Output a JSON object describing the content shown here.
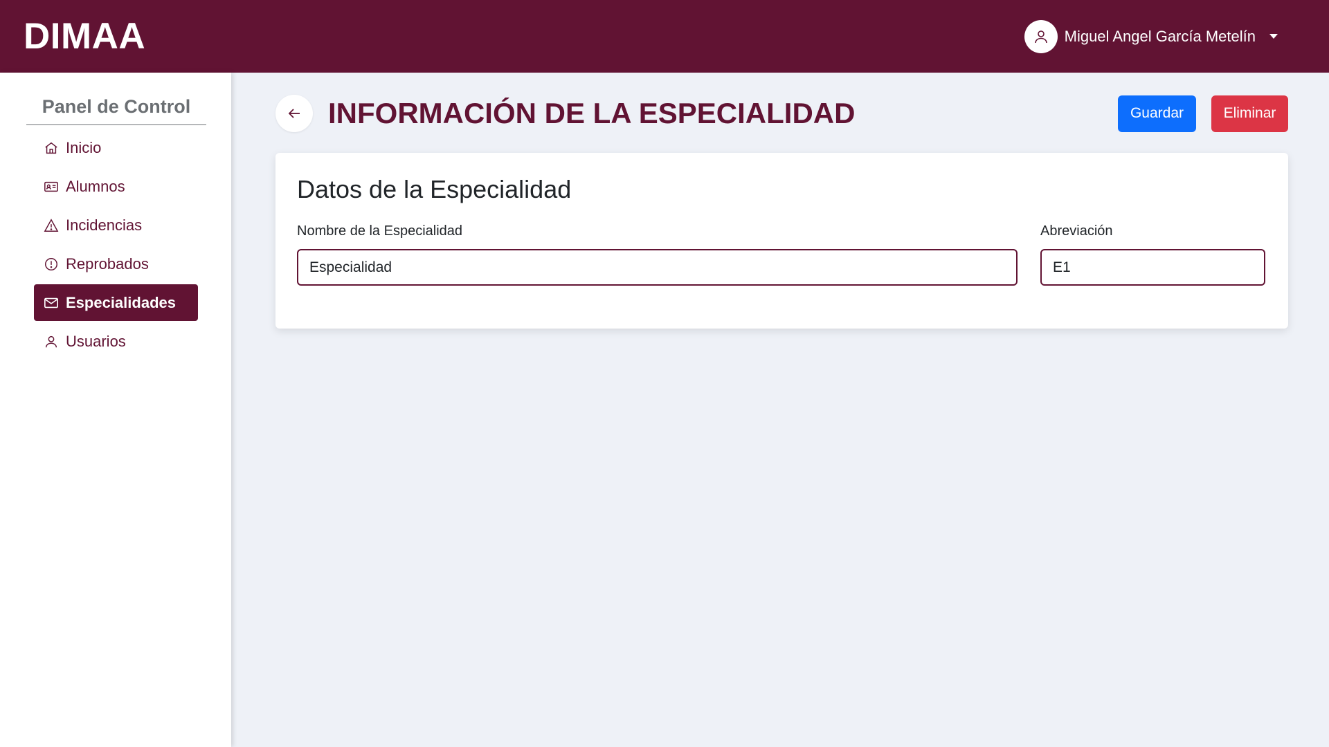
{
  "app": {
    "brand": "DIMAA",
    "user_name": "Miguel Angel García Metelín"
  },
  "sidebar": {
    "title": "Panel de Control",
    "items": [
      {
        "label": "Inicio",
        "icon": "home-icon"
      },
      {
        "label": "Alumnos",
        "icon": "id-card-icon"
      },
      {
        "label": "Incidencias",
        "icon": "warning-triangle-icon"
      },
      {
        "label": "Reprobados",
        "icon": "exclamation-circle-icon"
      },
      {
        "label": "Especialidades",
        "icon": "envelope-icon",
        "active": true
      },
      {
        "label": "Usuarios",
        "icon": "user-icon"
      }
    ]
  },
  "page": {
    "title": "INFORMACIÓN DE LA ESPECIALIDAD",
    "save_label": "Guardar",
    "delete_label": "Eliminar"
  },
  "card": {
    "title": "Datos de la Especialidad",
    "name_label": "Nombre de la Especialidad",
    "name_value": "Especialidad",
    "abbr_label": "Abreviación",
    "abbr_value": "E1"
  },
  "colors": {
    "brand": "#611333",
    "background": "#eef1f7",
    "save": "#0d6efd",
    "delete": "#dc3545"
  }
}
